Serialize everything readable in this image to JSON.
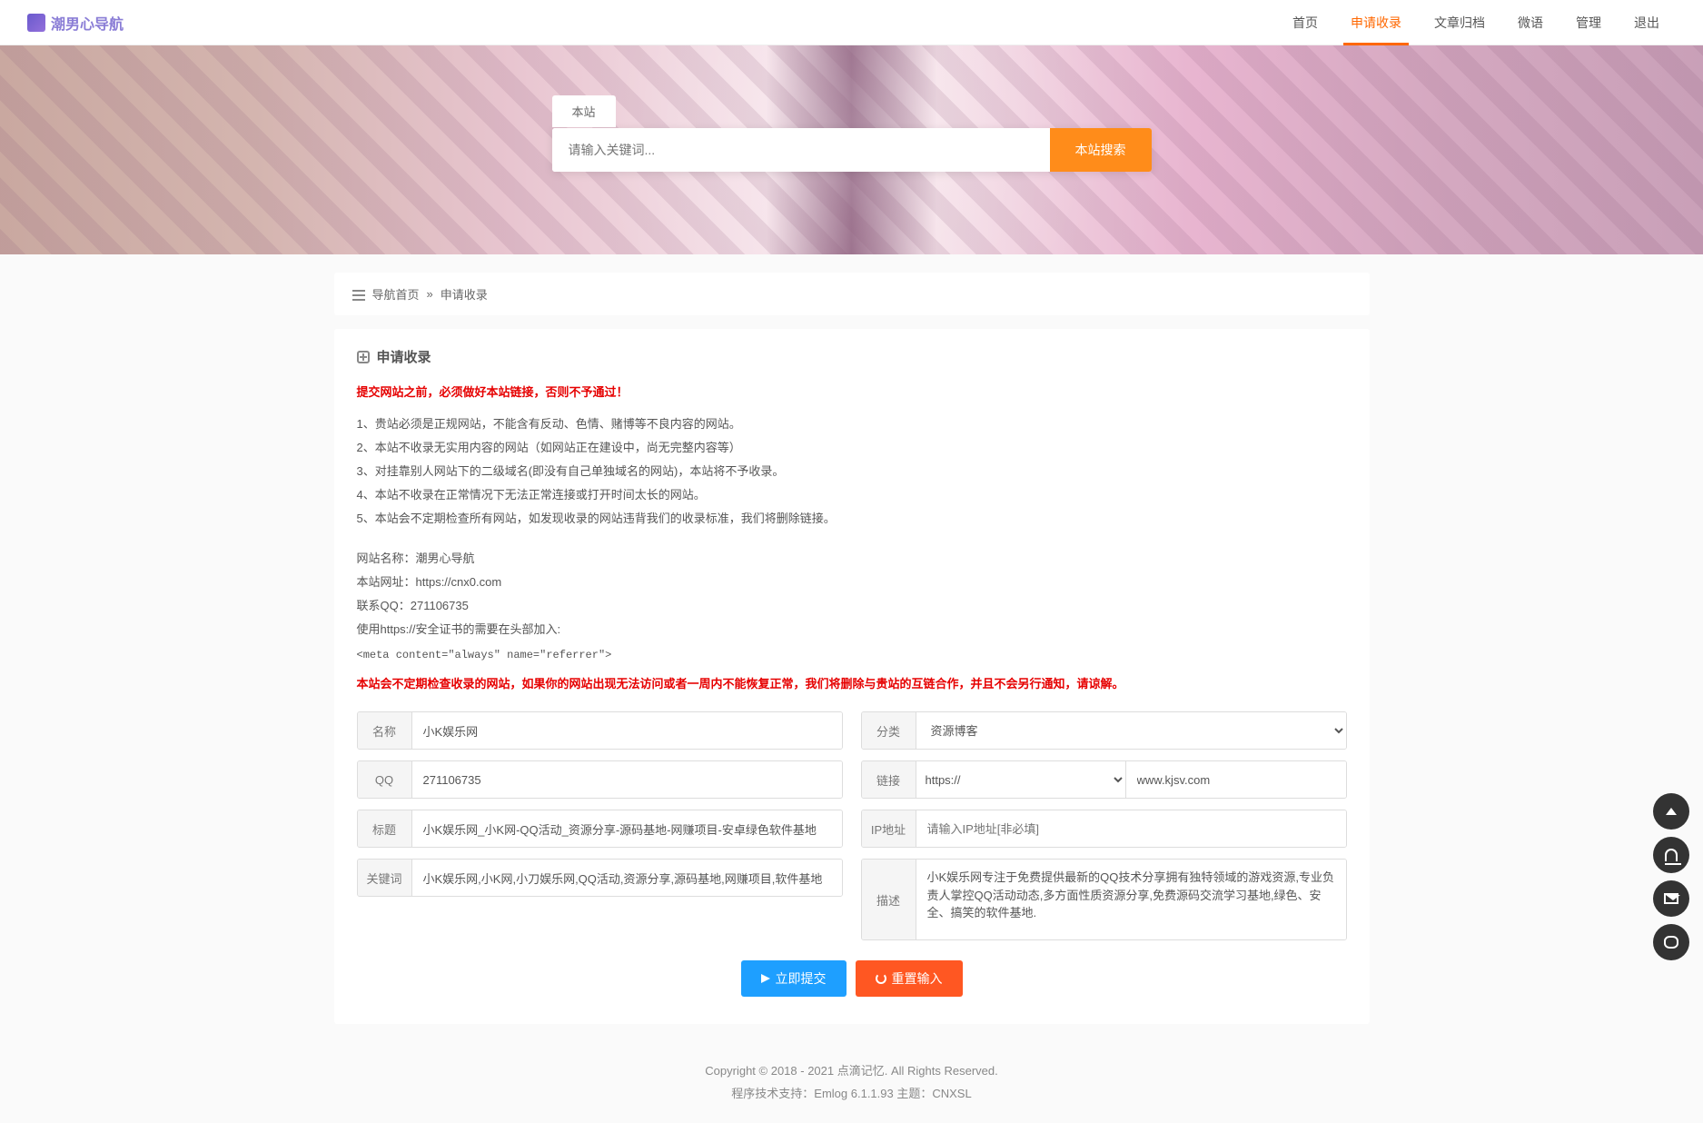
{
  "nav": {
    "logo": "潮男心导航",
    "items": [
      "首页",
      "申请收录",
      "文章归档",
      "微语",
      "管理",
      "退出"
    ],
    "active_index": 1
  },
  "search": {
    "tab": "本站",
    "placeholder": "请输入关键词...",
    "button": "本站搜索"
  },
  "breadcrumb": {
    "home": "导航首页",
    "sep": "»",
    "current": "申请收录"
  },
  "panel": {
    "title": "申请收录",
    "warn_top": "提交网站之前，必须做好本站链接，否则不予通过！",
    "rules": [
      "1、贵站必须是正规网站，不能含有反动、色情、赌博等不良内容的网站。",
      "2、本站不收录无实用内容的网站（如网站正在建设中，尚无完整内容等）",
      "3、对挂靠别人网站下的二级域名(即没有自己单独域名的网站)，本站将不予收录。",
      "4、本站不收录在正常情况下无法正常连接或打开时间太长的网站。",
      "5、本站会不定期检查所有网站，如发现收录的网站违背我们的收录标准，我们将删除链接。"
    ],
    "site_info": {
      "name_label": "网站名称：",
      "name": "潮男心导航",
      "url_label": "本站网址：",
      "url": "https://cnx0.com",
      "qq_label": "联系QQ：",
      "qq": "271106735",
      "https_note": "使用https://安全证书的需要在头部加入:"
    },
    "meta_tag": "<meta content=\"always\" name=\"referrer\">",
    "warn_bottom": "本站会不定期检查收录的网站，如果你的网站出现无法访问或者一周内不能恢复正常，我们将删除与贵站的互链合作，并且不会另行通知，请谅解。"
  },
  "form": {
    "name": {
      "label": "名称",
      "value": "小K娱乐网"
    },
    "category": {
      "label": "分类",
      "selected": "资源博客"
    },
    "qq": {
      "label": "QQ",
      "value": "271106735"
    },
    "link": {
      "label": "链接",
      "protocol": "https://",
      "value": "www.kjsv.com"
    },
    "title": {
      "label": "标题",
      "value": "小K娱乐网_小K网-QQ活动_资源分享-源码基地-网赚项目-安卓绿色软件基地"
    },
    "ip": {
      "label": "IP地址",
      "placeholder": "请输入IP地址[非必填]"
    },
    "keywords": {
      "label": "关键词",
      "value": "小K娱乐网,小K网,小刀娱乐网,QQ活动,资源分享,源码基地,网赚项目,软件基地"
    },
    "desc": {
      "label": "描述",
      "value": "小K娱乐网专注于免费提供最新的QQ技术分享拥有独特领域的游戏资源,专业负责人掌控QQ活动动态,多方面性质资源分享,免费源码交流学习基地,绿色、安全、搞笑的软件基地."
    },
    "submit": "立即提交",
    "reset": "重置输入"
  },
  "footer": {
    "line1": "Copyright © 2018 - 2021 点滴记忆. All Rights Reserved.",
    "line2_prefix": "程序技术支持：",
    "line2_tech": "Emlog 6.1.1.93",
    "line2_theme_prefix": " 主题：",
    "line2_theme": "CNXSL"
  }
}
